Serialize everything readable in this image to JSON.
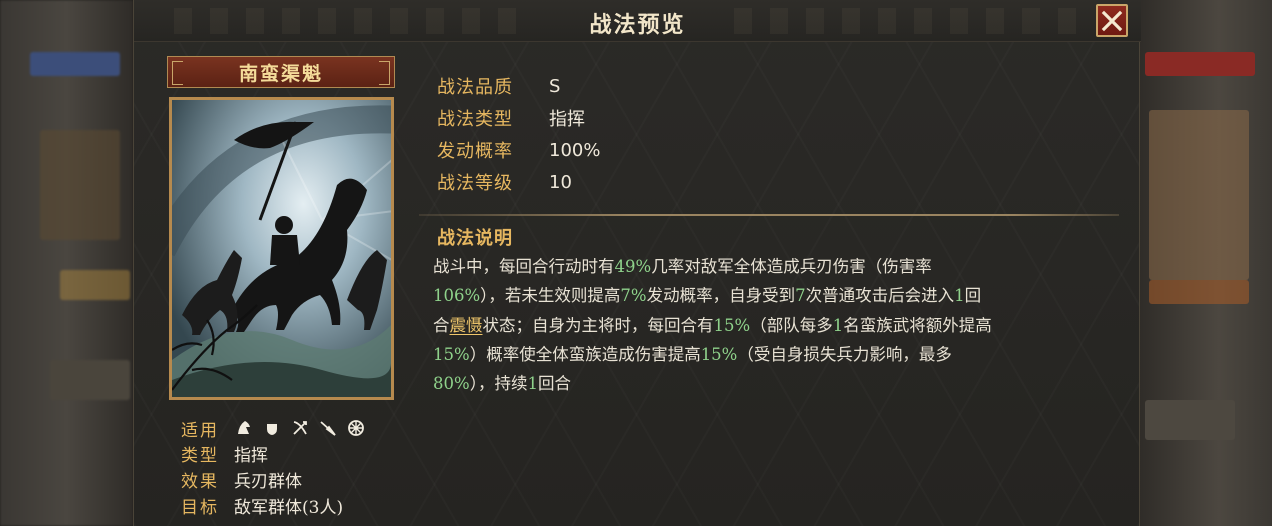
{
  "dialog": {
    "title": "战法预览",
    "close_label": "close"
  },
  "card": {
    "name": "南蛮渠魁",
    "art_description": "cavalry-charge-artwork"
  },
  "info": {
    "applicable_label": "适用",
    "applicable_icons": [
      "shield-cavalry-icon",
      "shield-infantry-icon",
      "crossbow-archer-icon",
      "spear-icon",
      "siege-wheel-icon"
    ],
    "type_label": "类型",
    "type_value": "指挥",
    "effect_label": "效果",
    "effect_value": "兵刃群体",
    "target_label": "目标",
    "target_value": "敌军群体(3人)"
  },
  "stats": [
    {
      "label": "战法品质",
      "value": "S"
    },
    {
      "label": "战法类型",
      "value": "指挥"
    },
    {
      "label": "发动概率",
      "value": "100%"
    },
    {
      "label": "战法等级",
      "value": "10"
    }
  ],
  "description": {
    "title": "战法说明",
    "segments": [
      {
        "t": "战斗中，每回合行动时有",
        "c": ""
      },
      {
        "t": "49%",
        "c": "hl"
      },
      {
        "t": "几率对敌军全体造成兵刃伤害（伤害率",
        "c": ""
      },
      {
        "t": "\n",
        "c": "br"
      },
      {
        "t": "106%",
        "c": "hl"
      },
      {
        "t": "），若未生效则提高",
        "c": ""
      },
      {
        "t": "7%",
        "c": "hl"
      },
      {
        "t": "发动概率，自身受到",
        "c": ""
      },
      {
        "t": "7",
        "c": "hl"
      },
      {
        "t": "次普通攻击后会进入",
        "c": ""
      },
      {
        "t": "1",
        "c": "hl"
      },
      {
        "t": "回",
        "c": ""
      },
      {
        "t": "\n",
        "c": "br"
      },
      {
        "t": "合",
        "c": ""
      },
      {
        "t": "震慑",
        "c": "kw"
      },
      {
        "t": "状态；自身为主将时，每回合有",
        "c": ""
      },
      {
        "t": "15%",
        "c": "hl"
      },
      {
        "t": "（部队每多",
        "c": ""
      },
      {
        "t": "1",
        "c": "hl"
      },
      {
        "t": "名蛮族武将额外提高",
        "c": ""
      },
      {
        "t": "\n",
        "c": "br"
      },
      {
        "t": "15%",
        "c": "hl"
      },
      {
        "t": "）概率使全体蛮族造成伤害提高",
        "c": ""
      },
      {
        "t": "15%",
        "c": "hl"
      },
      {
        "t": "（受自身损失兵力影响，最多",
        "c": ""
      },
      {
        "t": "\n",
        "c": "br"
      },
      {
        "t": "80%",
        "c": "hl"
      },
      {
        "t": "），持续",
        "c": ""
      },
      {
        "t": "1",
        "c": "hl"
      },
      {
        "t": "回合",
        "c": ""
      }
    ]
  },
  "colors": {
    "label_gold": "#e6b760",
    "value_text": "#efe8da",
    "highlight_green": "#8fd28b",
    "close_red": "#8e2a1e"
  }
}
